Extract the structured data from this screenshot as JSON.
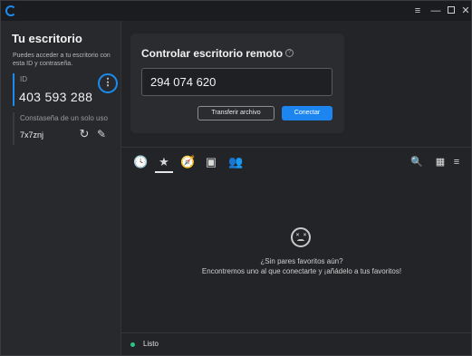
{
  "titlebar": {
    "app_logo": "rustdesk-logo",
    "menu_glyph": "≡",
    "minimize_glyph": "—",
    "close_glyph": "✕"
  },
  "sidebar": {
    "title": "Tu escritorio",
    "description": "Puedes acceder a tu escritorio con esta ID y contraseña.",
    "id_label": "ID",
    "id_value": "403 593 288",
    "id_menu_glyph": "⋮",
    "password_label": "Constaseña de un solo uso",
    "password_value": "7x7znj",
    "refresh_glyph": "↻",
    "edit_glyph": "✎"
  },
  "remote": {
    "title": "Controlar escritorio remoto",
    "help_glyph": "?",
    "input_value": "294 074 620",
    "transfer_label": "Transferir archivo",
    "connect_label": "Conectar"
  },
  "peers": {
    "tabs": [
      {
        "icon": "history-icon",
        "glyph": "🕓"
      },
      {
        "icon": "star-icon",
        "glyph": "★"
      },
      {
        "icon": "compass-icon",
        "glyph": "🧭"
      },
      {
        "icon": "address-book-icon",
        "glyph": "▣"
      },
      {
        "icon": "group-icon",
        "glyph": "👥"
      }
    ],
    "active_tab": "star-icon",
    "search_glyph": "🔍",
    "grid_glyph": "▦",
    "sort_glyph": "≡",
    "empty_line1": "¿Sin pares favoritos aún?",
    "empty_line2": "Encontremos uno al que conectarte y ¡añádelo a tus favoritos!"
  },
  "status": {
    "text": "Listo",
    "color": "#2fc28a"
  },
  "colors": {
    "accent": "#1d85f0",
    "background": "#232427",
    "sidebar": "#28292d"
  }
}
